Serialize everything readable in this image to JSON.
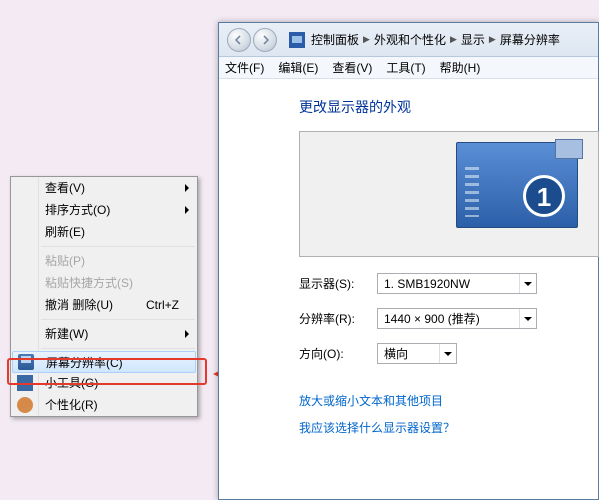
{
  "context_menu": {
    "items": [
      {
        "label": "查看(V)",
        "submenu": true
      },
      {
        "label": "排序方式(O)",
        "submenu": true
      },
      {
        "label": "刷新(E)"
      },
      {
        "type": "sep"
      },
      {
        "label": "粘贴(P)",
        "disabled": true
      },
      {
        "label": "粘贴快捷方式(S)",
        "disabled": true
      },
      {
        "label": "撤消 删除(U)",
        "shortcut": "Ctrl+Z"
      },
      {
        "type": "sep"
      },
      {
        "label": "新建(W)",
        "submenu": true
      },
      {
        "type": "sep"
      },
      {
        "label": "屏幕分辨率(C)",
        "icon": "monitor",
        "highlighted": true
      },
      {
        "label": "小工具(G)",
        "icon": "gadget"
      },
      {
        "label": "个性化(R)",
        "icon": "person"
      }
    ]
  },
  "window": {
    "breadcrumbs": [
      "控制面板",
      "外观和个性化",
      "显示",
      "屏幕分辨率"
    ],
    "menubar": [
      "文件(F)",
      "编辑(E)",
      "查看(V)",
      "工具(T)",
      "帮助(H)"
    ],
    "heading": "更改显示器的外观",
    "monitor_number": "1",
    "form": {
      "display_label": "显示器(S):",
      "display_value": "1. SMB1920NW",
      "resolution_label": "分辨率(R):",
      "resolution_value": "1440 × 900 (推荐)",
      "orientation_label": "方向(O):",
      "orientation_value": "横向"
    },
    "links": {
      "text_scaling": "放大或缩小文本和其他项目",
      "which_display": "我应该选择什么显示器设置？"
    }
  },
  "callout": {
    "color": "#e53a2b"
  }
}
